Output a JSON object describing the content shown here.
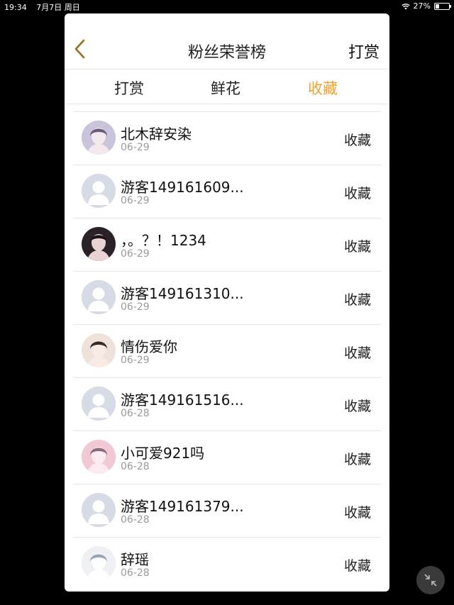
{
  "status_bar": {
    "time": "19:34",
    "date": "7月7日 周日",
    "battery": "27%",
    "battery_level": 0.27,
    "icons": [
      "wifi-icon",
      "battery-icon"
    ]
  },
  "header": {
    "back_icon": "chevron-left-icon",
    "title": "粉丝荣誉榜",
    "action_label": "打赏"
  },
  "tabs": [
    {
      "label": "打赏",
      "active": false
    },
    {
      "label": "鲜花",
      "active": false
    },
    {
      "label": "收藏",
      "active": true
    }
  ],
  "colors": {
    "accent": "#f0a030",
    "back_icon": "#c8a24a"
  },
  "rows": [
    {
      "name": "北木辞安染",
      "date": "06-29",
      "action": "收藏",
      "avatar": "photo-avatar"
    },
    {
      "name": "游客149161609...",
      "date": "06-29",
      "action": "收藏",
      "avatar": "default-avatar"
    },
    {
      "name": "，。？！1234",
      "date": "06-29",
      "action": "收藏",
      "avatar": "photo-avatar"
    },
    {
      "name": "游客149161310...",
      "date": "06-29",
      "action": "收藏",
      "avatar": "default-avatar"
    },
    {
      "name": "情伤爱你",
      "date": "06-29",
      "action": "收藏",
      "avatar": "photo-avatar"
    },
    {
      "name": "游客149161516...",
      "date": "06-28",
      "action": "收藏",
      "avatar": "default-avatar"
    },
    {
      "name": "小可爱921吗",
      "date": "06-28",
      "action": "收藏",
      "avatar": "photo-avatar"
    },
    {
      "name": "游客149161379...",
      "date": "06-28",
      "action": "收藏",
      "avatar": "default-avatar"
    },
    {
      "name": "辞瑶",
      "date": "06-28",
      "action": "收藏",
      "avatar": "photo-avatar"
    }
  ],
  "floating_button_icon": "minimize-arrows-icon"
}
